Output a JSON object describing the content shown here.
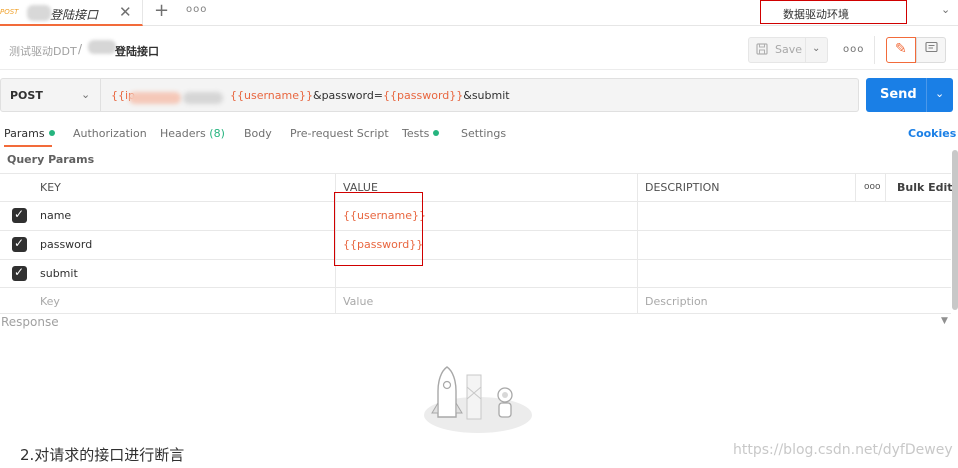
{
  "tab": {
    "method": "POST",
    "title": "登陆接口",
    "close_icon": "close-icon",
    "add_icon": "plus-icon",
    "more_label": "ooo"
  },
  "environment": {
    "selected": "数据驱动环境"
  },
  "breadcrumb": {
    "collection": "测试驱动DDT",
    "separator": "/",
    "request": "登陆接口"
  },
  "toolbar": {
    "save_label": "Save",
    "more_label": "ooo"
  },
  "request": {
    "method": "POST",
    "url_prefix": "{{ip",
    "url_parts": [
      {
        "text": "{{username}}",
        "kind": "var"
      },
      {
        "text": "&password=",
        "kind": "text"
      },
      {
        "text": "{{password}}",
        "kind": "var"
      },
      {
        "text": "&submit",
        "kind": "text"
      }
    ],
    "send_label": "Send"
  },
  "request_tabs": {
    "params": "Params",
    "authorization": "Authorization",
    "headers": "Headers",
    "headers_count": "(8)",
    "body": "Body",
    "prerequest": "Pre-request Script",
    "tests": "Tests",
    "settings": "Settings",
    "cookies": "Cookies"
  },
  "query_params": {
    "title": "Query Params",
    "columns": {
      "key": "KEY",
      "value": "VALUE",
      "description": "DESCRIPTION",
      "more": "ooo",
      "bulk_edit": "Bulk Edit"
    },
    "rows": [
      {
        "key": "name",
        "value": "{{username}}",
        "checked": true
      },
      {
        "key": "password",
        "value": "{{password}}",
        "checked": true
      },
      {
        "key": "submit",
        "value": "",
        "checked": true
      }
    ],
    "placeholders": {
      "key": "Key",
      "value": "Value",
      "description": "Description"
    }
  },
  "response": {
    "label": "Response"
  },
  "caption": "2.对请求的接口进行断言",
  "watermark": "https://blog.csdn.net/dyfDewey",
  "colors": {
    "accent": "#f26b3a",
    "send": "#1a7fe6",
    "variable": "#e8663f",
    "annotation": "#d00000",
    "status_dot": "#26b47f"
  }
}
